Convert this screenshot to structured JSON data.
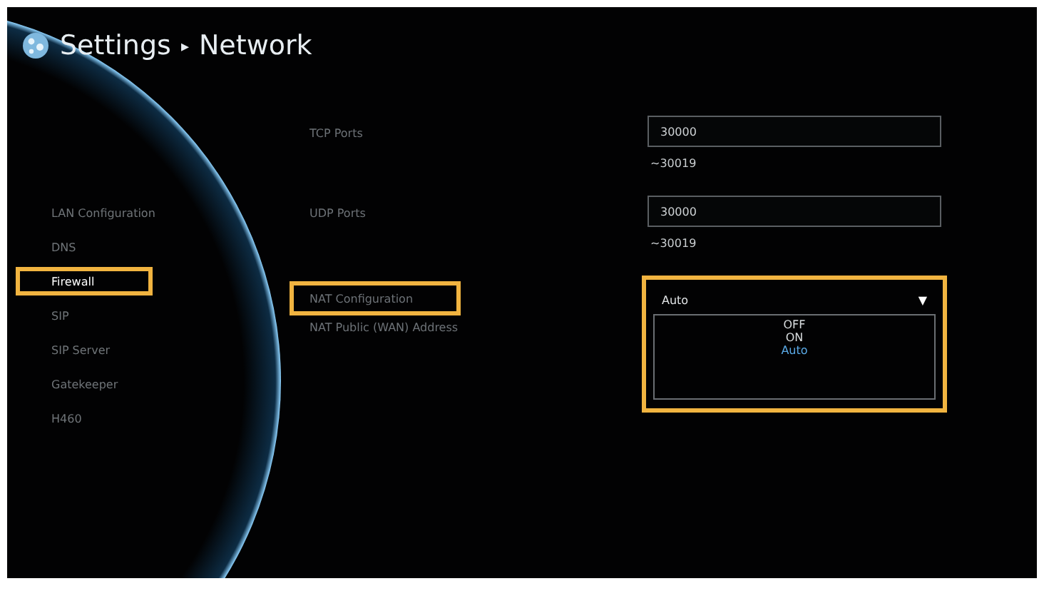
{
  "header": {
    "title": "Settings",
    "separator": "▸",
    "subtitle": "Network"
  },
  "sidebar": {
    "items": [
      {
        "label": "LAN Configuration",
        "selected": false,
        "highlighted": false
      },
      {
        "label": "DNS",
        "selected": false,
        "highlighted": false
      },
      {
        "label": "Firewall",
        "selected": true,
        "highlighted": true
      },
      {
        "label": "SIP",
        "selected": false,
        "highlighted": false
      },
      {
        "label": "SIP Server",
        "selected": false,
        "highlighted": false
      },
      {
        "label": "Gatekeeper",
        "selected": false,
        "highlighted": false
      },
      {
        "label": "H460",
        "selected": false,
        "highlighted": false
      }
    ]
  },
  "port_rows": [
    {
      "label": "TCP Ports",
      "value": "30000",
      "range": "~30019"
    },
    {
      "label": "UDP Ports",
      "value": "30000",
      "range": "~30019"
    }
  ],
  "nat_configuration": {
    "label": "NAT Configuration",
    "label_highlighted": true,
    "value": "Auto",
    "arrow": "▼",
    "expanded": true,
    "highlighted": true,
    "options": [
      {
        "label": "OFF",
        "selected": false
      },
      {
        "label": "ON",
        "selected": false
      },
      {
        "label": "Auto",
        "selected": true
      }
    ]
  },
  "nat_public_address": {
    "label": "NAT Public (WAN) Address"
  }
}
